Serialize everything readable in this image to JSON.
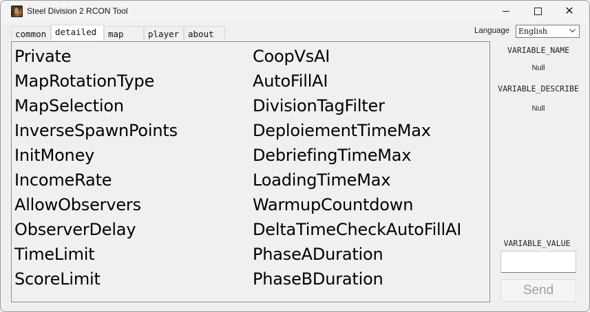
{
  "window": {
    "title": "Steel Division 2 RCON Tool",
    "app_icon": "app-logo-icon",
    "controls": {
      "minimize": "minimize-icon",
      "maximize": "maximize-icon",
      "close": "close-icon"
    }
  },
  "tabs": [
    {
      "label": "common",
      "active": false
    },
    {
      "label": "detailed",
      "active": true
    },
    {
      "label": "map",
      "active": false
    },
    {
      "label": "player",
      "active": false
    },
    {
      "label": "about",
      "active": false
    }
  ],
  "language": {
    "label": "Language",
    "selected": "English",
    "icon": "chevron-down-icon"
  },
  "variables": {
    "left": [
      "Private",
      "MapRotationType",
      "MapSelection",
      "InverseSpawnPoints",
      "InitMoney",
      "IncomeRate",
      "AllowObservers",
      "ObserverDelay",
      "TimeLimit",
      "ScoreLimit"
    ],
    "right": [
      "CoopVsAI",
      "AutoFillAI",
      "DivisionTagFilter",
      "DeploiementTimeMax",
      "DebriefingTimeMax",
      "LoadingTimeMax",
      "WarmupCountdown",
      "DeltaTimeCheckAutoFillAI",
      "PhaseADuration",
      "PhaseBDuration"
    ]
  },
  "side": {
    "name_label": "VARIABLE_NAME",
    "name_value": "Null",
    "describe_label": "VARIABLE_DESCRIBE",
    "describe_value": "Null",
    "value_label": "VARIABLE_VALUE",
    "value_input": "",
    "send_label": "Send"
  },
  "colors": {
    "window_bg": "#f0f0f0",
    "send_disabled_text": "#a0a0a0"
  }
}
